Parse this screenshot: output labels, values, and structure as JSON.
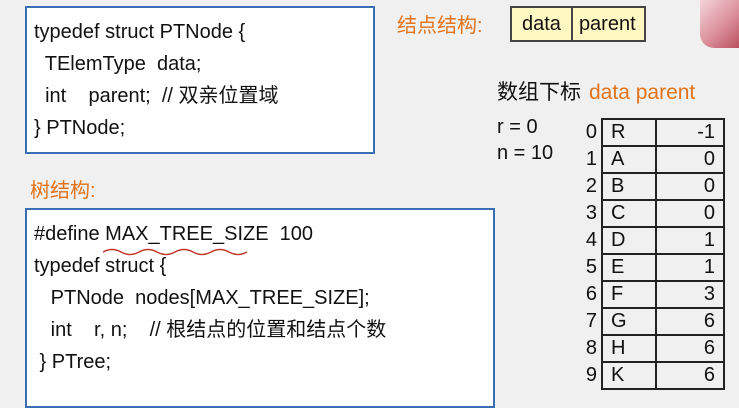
{
  "ptnode_code": {
    "lines": [
      "typedef struct PTNode {",
      "  TElemType  data;",
      "  int    parent;  // 双亲位置域",
      "} PTNode;"
    ]
  },
  "node_structure": {
    "label": "结点结构:",
    "fields": [
      "data",
      "parent"
    ]
  },
  "tree_structure": {
    "label": "树结构:",
    "define_prefix": "#define ",
    "define_macro": "MAX_TREE_SIZE",
    "define_value": "  100",
    "lines": [
      "typedef struct {",
      "   PTNode  nodes[MAX_TREE_SIZE];",
      "   int    r, n;    // 根结点的位置和结点个数",
      " } PTree;"
    ]
  },
  "array_table": {
    "index_header": "数组下标",
    "data_header": "data",
    "parent_header": "parent",
    "r_text": "r = 0",
    "n_text": "n = 10",
    "rows": [
      {
        "index": "0",
        "data": "R",
        "parent": "-1"
      },
      {
        "index": "1",
        "data": "A",
        "parent": "0"
      },
      {
        "index": "2",
        "data": "B",
        "parent": "0"
      },
      {
        "index": "3",
        "data": "C",
        "parent": "0"
      },
      {
        "index": "4",
        "data": "D",
        "parent": "1"
      },
      {
        "index": "5",
        "data": "E",
        "parent": "1"
      },
      {
        "index": "6",
        "data": "F",
        "parent": "3"
      },
      {
        "index": "7",
        "data": "G",
        "parent": "6"
      },
      {
        "index": "8",
        "data": "H",
        "parent": "6"
      },
      {
        "index": "9",
        "data": "K",
        "parent": "6"
      }
    ]
  },
  "colors": {
    "accent": "#e3731a",
    "box_border": "#3b6fb5",
    "node_fill": "#fff8c2",
    "squiggle": "#c0392b"
  }
}
